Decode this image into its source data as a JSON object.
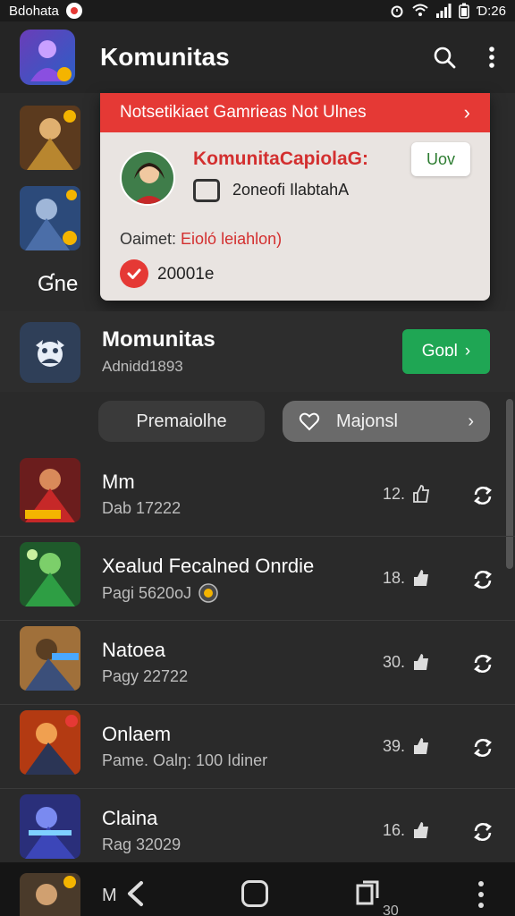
{
  "status": {
    "left_label": "Bdohata",
    "time": "Ɗ:26"
  },
  "appbar": {
    "title": "Komunitas"
  },
  "side": {
    "label": "Ɠne"
  },
  "popup": {
    "banner": "Notsetikiaet Gamrieas Not Ulnes",
    "title": "KomunitaCapiolaG:",
    "button": "Uov",
    "subtitle": "2oneofi IlabtahA",
    "content_label": "Oaimet:",
    "content_value": "Eioló leiahlon)",
    "badge_text": "20001e"
  },
  "community": {
    "name": "Momunitas",
    "meta": "Adnidd1893",
    "join_label": "Goɒl"
  },
  "tabs": {
    "left": "Premaiolhe",
    "right": "Majonsl"
  },
  "posts": [
    {
      "title": "Mm",
      "subtitle": "Dab 17222",
      "count": "12."
    },
    {
      "title": "Xealud Fecalned Onrdie",
      "subtitle": "Pagi 5620oJ",
      "count": "18."
    },
    {
      "title": "Natoea",
      "subtitle": "Pagy 22722",
      "count": "30."
    },
    {
      "title": "Onlaem",
      "subtitle": "Pame. Oalŋ: 100 Idiner",
      "count": "39."
    },
    {
      "title": "Claina",
      "subtitle": "Rag 32029",
      "count": "16."
    }
  ],
  "navbar": {
    "label": "M",
    "count": "30"
  },
  "colors": {
    "accent_red": "#e53935",
    "accent_green": "#1fa654",
    "background": "#2a2a2a"
  }
}
